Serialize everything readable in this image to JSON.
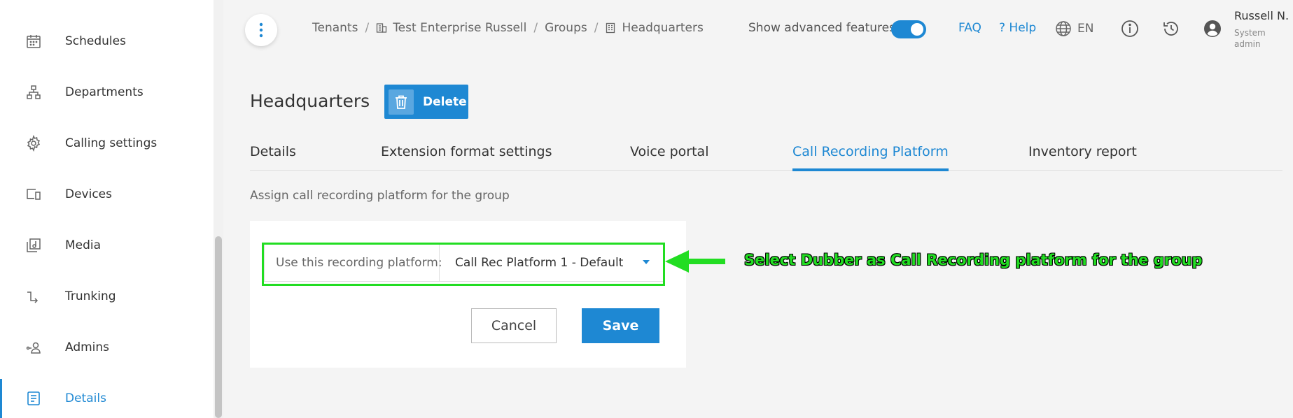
{
  "sidebar": {
    "items": [
      {
        "label": "Schedules",
        "icon": "calendar-icon"
      },
      {
        "label": "Departments",
        "icon": "org-chart-icon"
      },
      {
        "label": "Calling settings",
        "icon": "gear-icon"
      },
      {
        "label": "Devices",
        "icon": "devices-icon"
      },
      {
        "label": "Media",
        "icon": "media-icon"
      },
      {
        "label": "Trunking",
        "icon": "trunking-icon"
      },
      {
        "label": "Admins",
        "icon": "admins-icon"
      },
      {
        "label": "Details",
        "icon": "details-icon",
        "active": true
      }
    ]
  },
  "breadcrumb": {
    "items": [
      "Tenants",
      "Test Enterprise Russell",
      "Groups",
      "Headquarters"
    ],
    "separator": "/"
  },
  "topbar": {
    "advanced_label": "Show advanced features",
    "advanced_enabled": true,
    "faq": "FAQ",
    "help": "? Help",
    "lang": "EN",
    "user_name": "Russell N.",
    "user_role": "System admin"
  },
  "page": {
    "title": "Headquarters",
    "delete_label": "Delete"
  },
  "tabs": [
    {
      "label": "Details"
    },
    {
      "label": "Extension format settings"
    },
    {
      "label": "Voice portal"
    },
    {
      "label": "Call Recording Platform",
      "active": true
    },
    {
      "label": "Inventory report"
    }
  ],
  "form": {
    "description": "Assign call recording platform for the group",
    "field_label": "Use this recording platform:",
    "selected_value": "Call Rec Platform 1 - Default",
    "cancel_label": "Cancel",
    "save_label": "Save"
  },
  "annotation": {
    "text": "Select Dubber as Call Recording platform for the group",
    "color": "#22dd22"
  },
  "colors": {
    "accent": "#1e88d3",
    "highlight": "#22dd22"
  }
}
